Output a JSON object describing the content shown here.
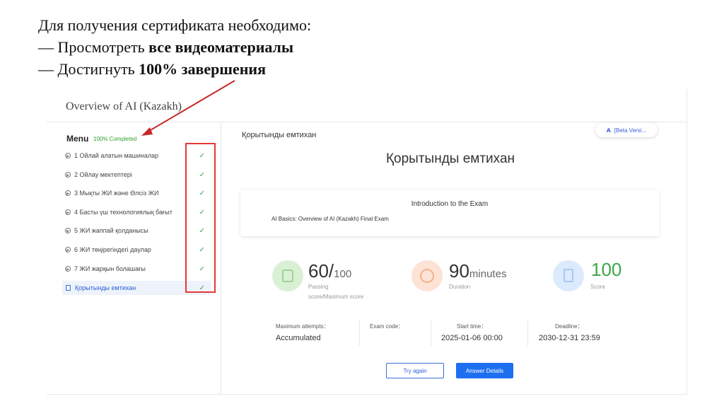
{
  "slide": {
    "line1": "Для получения сертификата необходимо:",
    "line2_prefix": "— Просмотреть ",
    "line2_bold": "все видеоматериалы",
    "line3_prefix": "— Достигнуть ",
    "line3_bold": "100% завершения"
  },
  "course": {
    "title": "Overview of AI (Kazakh)"
  },
  "menu": {
    "title": "Menu",
    "badge": "100% Completed",
    "items": [
      {
        "label": "1 Ойлай алатын машиналар"
      },
      {
        "label": "2 Ойлау мектептері"
      },
      {
        "label": "3 Мықты ЖИ және Өлсіз ЖИ"
      },
      {
        "label": "4 Басты үш технологиялық бағыт"
      },
      {
        "label": "5 ЖИ жаппай қолданысы"
      },
      {
        "label": "6 ЖИ төңірегіндегі даулар"
      },
      {
        "label": "7 ЖИ жарқын болашағы"
      },
      {
        "label": "Қорытынды емтихан"
      }
    ],
    "check": "✓"
  },
  "main": {
    "breadcrumb": "Қорытынды емтихан",
    "beta_logo": "ᴀ",
    "beta": "[Beta Versi...",
    "title": "Қорытынды емтихан",
    "intro_title": "Introduction to the Exam",
    "intro_sub": "AI Basics: Overview of AI (Kazakh) Final Exam"
  },
  "stats": {
    "passing_big": "60/",
    "passing_small": "100",
    "passing_label1": "Passing",
    "passing_label2": "score/Maximum score",
    "duration_big": "90",
    "duration_small": "minutes",
    "duration_label": "Duration",
    "score_big": "100",
    "score_label": "Score"
  },
  "info": {
    "attempts_label": "Maximum attempts：",
    "attempts_val": "Accumulated",
    "code_label": "Exam code：",
    "code_val": "",
    "start_label": "Start time：",
    "start_val": "2025-01-06 00:00",
    "deadline_label": "Deadline：",
    "deadline_val": "2030-12-31 23:59"
  },
  "buttons": {
    "try_again": "Try again",
    "answer_details": "Answer Details"
  },
  "colors": {
    "annotation_red": "#e53935",
    "complete_green": "#2fa12f",
    "primary_blue": "#1e6ff0",
    "passing_circle": "#d9f0d5",
    "duration_circle": "#fde3d6",
    "score_circle": "#dbeafc"
  }
}
